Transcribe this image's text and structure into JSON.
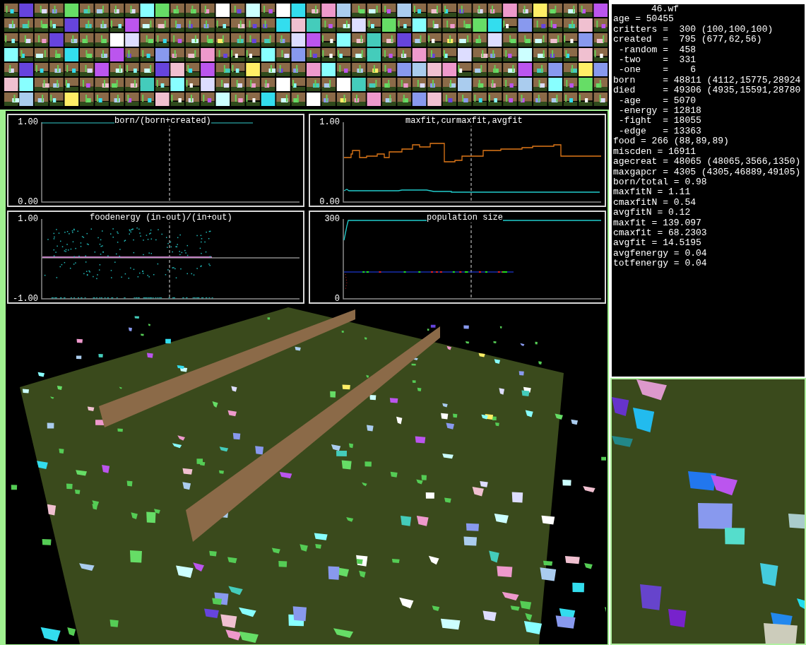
{
  "charts": [
    {
      "kind": "ratio",
      "title": "born/(born+created)",
      "y_max_label": "1.00",
      "y_min_label": "0.00"
    },
    {
      "kind": "fitness",
      "title": "maxfit,curmaxfit,avgfit",
      "y_max_label": "1.00",
      "y_min_label": "0.00"
    },
    {
      "kind": "scatter",
      "title": "foodenergy (in-out)/(in+out)",
      "y_max_label": "1.00",
      "y_min_label": "-1.00"
    },
    {
      "kind": "population",
      "title": "population size",
      "y_max_label": "300",
      "y_min_label": "0"
    }
  ],
  "stats_panel": {
    "title": "46.wf",
    "lines": [
      "age = 50455",
      "critters =  300 (100,100,100)",
      "created  =  795 (677,62,56)",
      " -random =  458",
      " -two    =  331",
      " -one    =    6",
      "born     = 48811 (4112,15775,28924",
      "died     = 49306 (4935,15591,28780",
      " -age    = 5070",
      " -energy = 12818",
      " -fight  = 18055",
      " -edge   = 13363",
      "food = 266 (88,89,89)",
      "miscden = 16911",
      "agecreat = 48065 (48065,3566,1350)",
      "maxgapcr = 4305 (4305,46889,49105)",
      "born/total = 0.98",
      "maxfitN = 1.11",
      "cmaxfitN = 0.54",
      "avgfitN = 0.12",
      "maxfit = 139.097",
      "cmaxfit = 68.2303",
      "avgfit = 14.5195",
      "avgfenergy = 0.04",
      "totfenergy = 0.04"
    ]
  }
}
